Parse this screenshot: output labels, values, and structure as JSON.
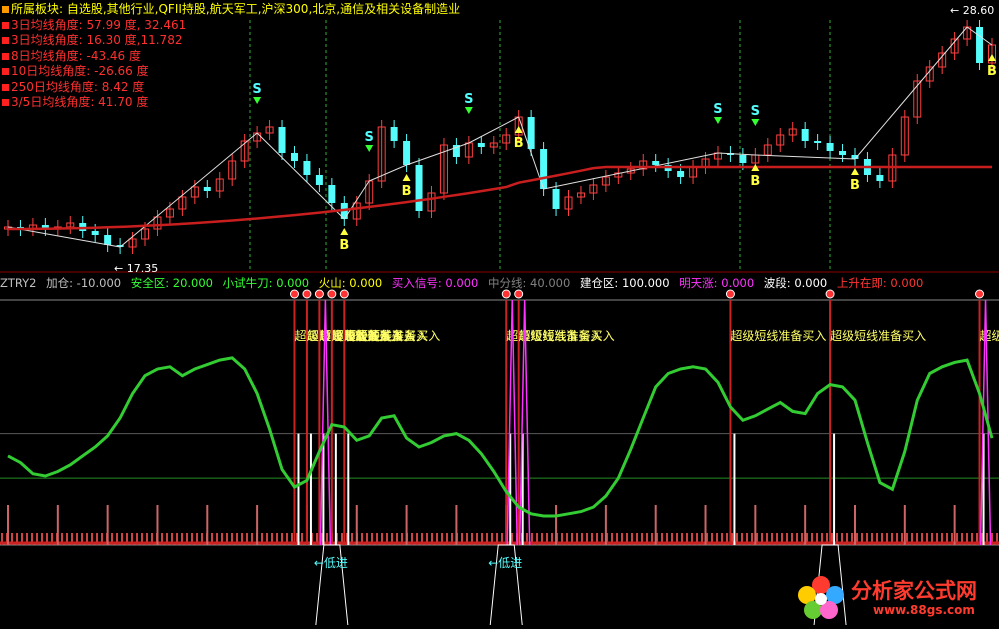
{
  "header": {
    "sector_label": "所属板块: 自选股,其他行业,QFII持股,航天军工,沪深300,北京,通信及相关设备制造业",
    "angles": [
      "3日均线角度:  57.99 度, 32.461",
      "3日均线角度:  16.30 度,11.782",
      "8日均线角度:  -43.46 度",
      "10日均线角度:  -26.66 度",
      "250日均线角度:  8.42 度",
      "3/5日均线角度:  41.70 度"
    ]
  },
  "price_labels": {
    "high": "28.60",
    "low": "17.35"
  },
  "indicator_bar": {
    "name": "ZTRY2",
    "items": [
      {
        "text": "加仓: -10.000",
        "color": "#c0c0c0"
      },
      {
        "text": "安全区: 20.000",
        "color": "#33ff33"
      },
      {
        "text": "小试牛刀: 0.000",
        "color": "#33ff33"
      },
      {
        "text": "火山: 0.000",
        "color": "#ffff00"
      },
      {
        "text": "买入信号: 0.000",
        "color": "#ff33ff"
      },
      {
        "text": "中分线: 40.000",
        "color": "#808080"
      },
      {
        "text": "建仓区: 100.000",
        "color": "#ffffff"
      },
      {
        "text": "明天涨: 0.000",
        "color": "#ff33ff"
      },
      {
        "text": "波段: 0.000",
        "color": "#ffffff"
      },
      {
        "text": "上升在即: 0.000",
        "color": "#ff3333"
      }
    ]
  },
  "signal_text": "超级短线准备买入",
  "low_text": "低进",
  "watermark": {
    "brand": "分析家公式网",
    "url": "www.88gs.com"
  },
  "colors": {
    "up": "#ff4040",
    "down": "#54fcfc",
    "ma250": "#c81e1e",
    "oscillator": "#33cc33",
    "signal_s": "#54fcfc",
    "signal_b": "#ffff40"
  },
  "chart_data": [
    {
      "type": "candlestick",
      "x_index": [
        0,
        79
      ],
      "ylim": [
        17.0,
        29.0
      ],
      "close": [
        18.4,
        18.3,
        18.5,
        18.3,
        18.4,
        18.6,
        18.2,
        18.0,
        17.5,
        17.4,
        17.8,
        18.3,
        18.9,
        19.3,
        19.9,
        20.4,
        20.2,
        20.8,
        21.7,
        22.7,
        23.1,
        23.4,
        22.1,
        21.7,
        21.0,
        20.5,
        19.6,
        18.8,
        19.6,
        20.7,
        23.4,
        22.7,
        21.5,
        19.2,
        20.1,
        22.5,
        21.9,
        22.6,
        22.4,
        22.6,
        23.0,
        23.9,
        22.3,
        20.3,
        19.3,
        19.9,
        20.1,
        20.5,
        20.9,
        21.1,
        21.3,
        21.7,
        21.5,
        21.2,
        20.9,
        21.4,
        21.8,
        22.1,
        22.0,
        21.6,
        22.0,
        22.5,
        23.0,
        23.3,
        22.7,
        22.6,
        22.2,
        22.0,
        21.8,
        21.0,
        20.7,
        22.0,
        23.9,
        25.7,
        26.4,
        27.1,
        27.8,
        28.4,
        26.6,
        27.5
      ],
      "s_marks": [
        20,
        29,
        37,
        57,
        60
      ],
      "b_marks": [
        27,
        32,
        41,
        60,
        68,
        79
      ],
      "high_label_at": 77,
      "low_label_at": 9
    },
    {
      "type": "line",
      "name": "ZTRY2",
      "x_index": [
        0,
        79
      ],
      "ylim": [
        -10,
        100
      ],
      "reference_lines": [
        -10,
        20,
        40,
        100
      ],
      "values": [
        30,
        27,
        22,
        21,
        23,
        26,
        30,
        34,
        39,
        47,
        58,
        66,
        69,
        70,
        66,
        69,
        71,
        73,
        74,
        69,
        58,
        42,
        24,
        16,
        19,
        32,
        44,
        43,
        37,
        39,
        47,
        48,
        38,
        34,
        36,
        39,
        40,
        37,
        31,
        23,
        14,
        7,
        4,
        3,
        3,
        4,
        5,
        7,
        12,
        20,
        33,
        47,
        61,
        67,
        69,
        70,
        69,
        63,
        52,
        46,
        48,
        51,
        54,
        50,
        49,
        58,
        62,
        61,
        55,
        36,
        18,
        15,
        32,
        55,
        67,
        70,
        72,
        73,
        58,
        38
      ],
      "signal_bars": [
        23,
        24,
        25,
        26,
        27,
        40,
        41,
        58,
        66,
        78
      ]
    }
  ]
}
